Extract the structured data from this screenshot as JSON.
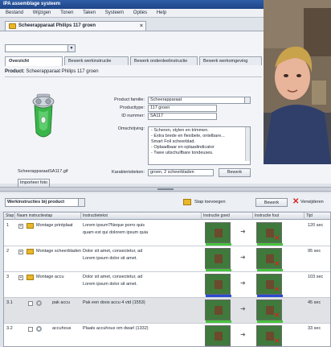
{
  "window": {
    "title": "IPA assemblage systeem"
  },
  "menu": [
    "Bestand",
    "Wijzigen",
    "Tonen",
    "Taken",
    "Systeem",
    "Opties",
    "Help"
  ],
  "document_tab": {
    "label": "Scheerapparaat Philips 117 groen"
  },
  "tabs": [
    {
      "label": "Overzicht",
      "active": true
    },
    {
      "label": "Bewerk werkinstructie",
      "active": false
    },
    {
      "label": "Bewerk onderdeelinstructie",
      "active": false
    },
    {
      "label": "Bewerk werkomgeving",
      "active": false
    }
  ],
  "product": {
    "prefix": "Product:",
    "name": "Scheerapparaat Philips 117 groen"
  },
  "fields": {
    "familie_label": "Product familie:",
    "familie_value": "Scheerapparaat",
    "type_label": "Producttype:",
    "type_value": "117 groen",
    "id_label": "ID nummer:",
    "id_value": "SA117",
    "omschrijving_label": "Omschrijving:",
    "omschrijving_lines": [
      "- Scheren, stylen en trimmen.",
      "- Extra brede en flexibele, ontelbare...",
      "  Smart Foil scheerblad.",
      "- Oplaadbaar en oplaadindicator",
      "- Twee uitschuifbare tondeuses."
    ],
    "kenmerken_label": "Karakteristieken:",
    "kenmerken_value": "groen, 2 scheerbladen",
    "bewerk_label": "Bewerk"
  },
  "image": {
    "filename": "ScheerapparaatSA117.gif",
    "import_label": "Importeer foto"
  },
  "lower_toolbar": {
    "combo_value": "Werkinstructies bij product",
    "stap_label": "Stap toevoegen",
    "bewerk_label": "Bewerk",
    "verwijder_label": "Verwijderen"
  },
  "table": {
    "headers": [
      "Stap",
      "Naam instructiestap",
      "Instructietekst",
      "Instructie goed",
      "Instructie fout",
      "Tijd"
    ],
    "rows": [
      {
        "stap": "1",
        "naam": "Montage printplaat",
        "tekst1": "Lorem ipsum?Neque porro quis",
        "tekst2": "quam est qui dolorem ipsum quia",
        "tijd": "120 sec",
        "kind": "folder",
        "bar": "#46c23c",
        "selected": false
      },
      {
        "stap": "2",
        "naam": "Montage scheerbladen",
        "tekst1": "Dolor sit amet, consectetur, ad",
        "tekst2": "Lorem ipsum dolor sit amet.",
        "tijd": "95 sec",
        "kind": "folder",
        "bar": "#46c23c",
        "selected": false
      },
      {
        "stap": "3",
        "naam": "Montage accu",
        "tekst1": "Dolor sit amet, consectetur, ad",
        "tekst2": "Lorem ipsum dolor sit amet.",
        "tijd": "103 sec",
        "kind": "folder",
        "bar": "#2a4bd4",
        "selected": false
      },
      {
        "stap": "3.1",
        "naam": "pak accu",
        "tekst1": "Pak een doos accu 4 vtd (1553)",
        "tekst2": "",
        "tijd": "45 sec",
        "kind": "gear",
        "bar": "#46c23c",
        "selected": true
      },
      {
        "stap": "3.2",
        "naam": "accuhous",
        "tekst1": "Plaats accuhous om dwarl (1332)",
        "tekst2": "",
        "tijd": "33 sec",
        "kind": "gear",
        "bar": "#46c23c",
        "selected": false
      }
    ]
  }
}
